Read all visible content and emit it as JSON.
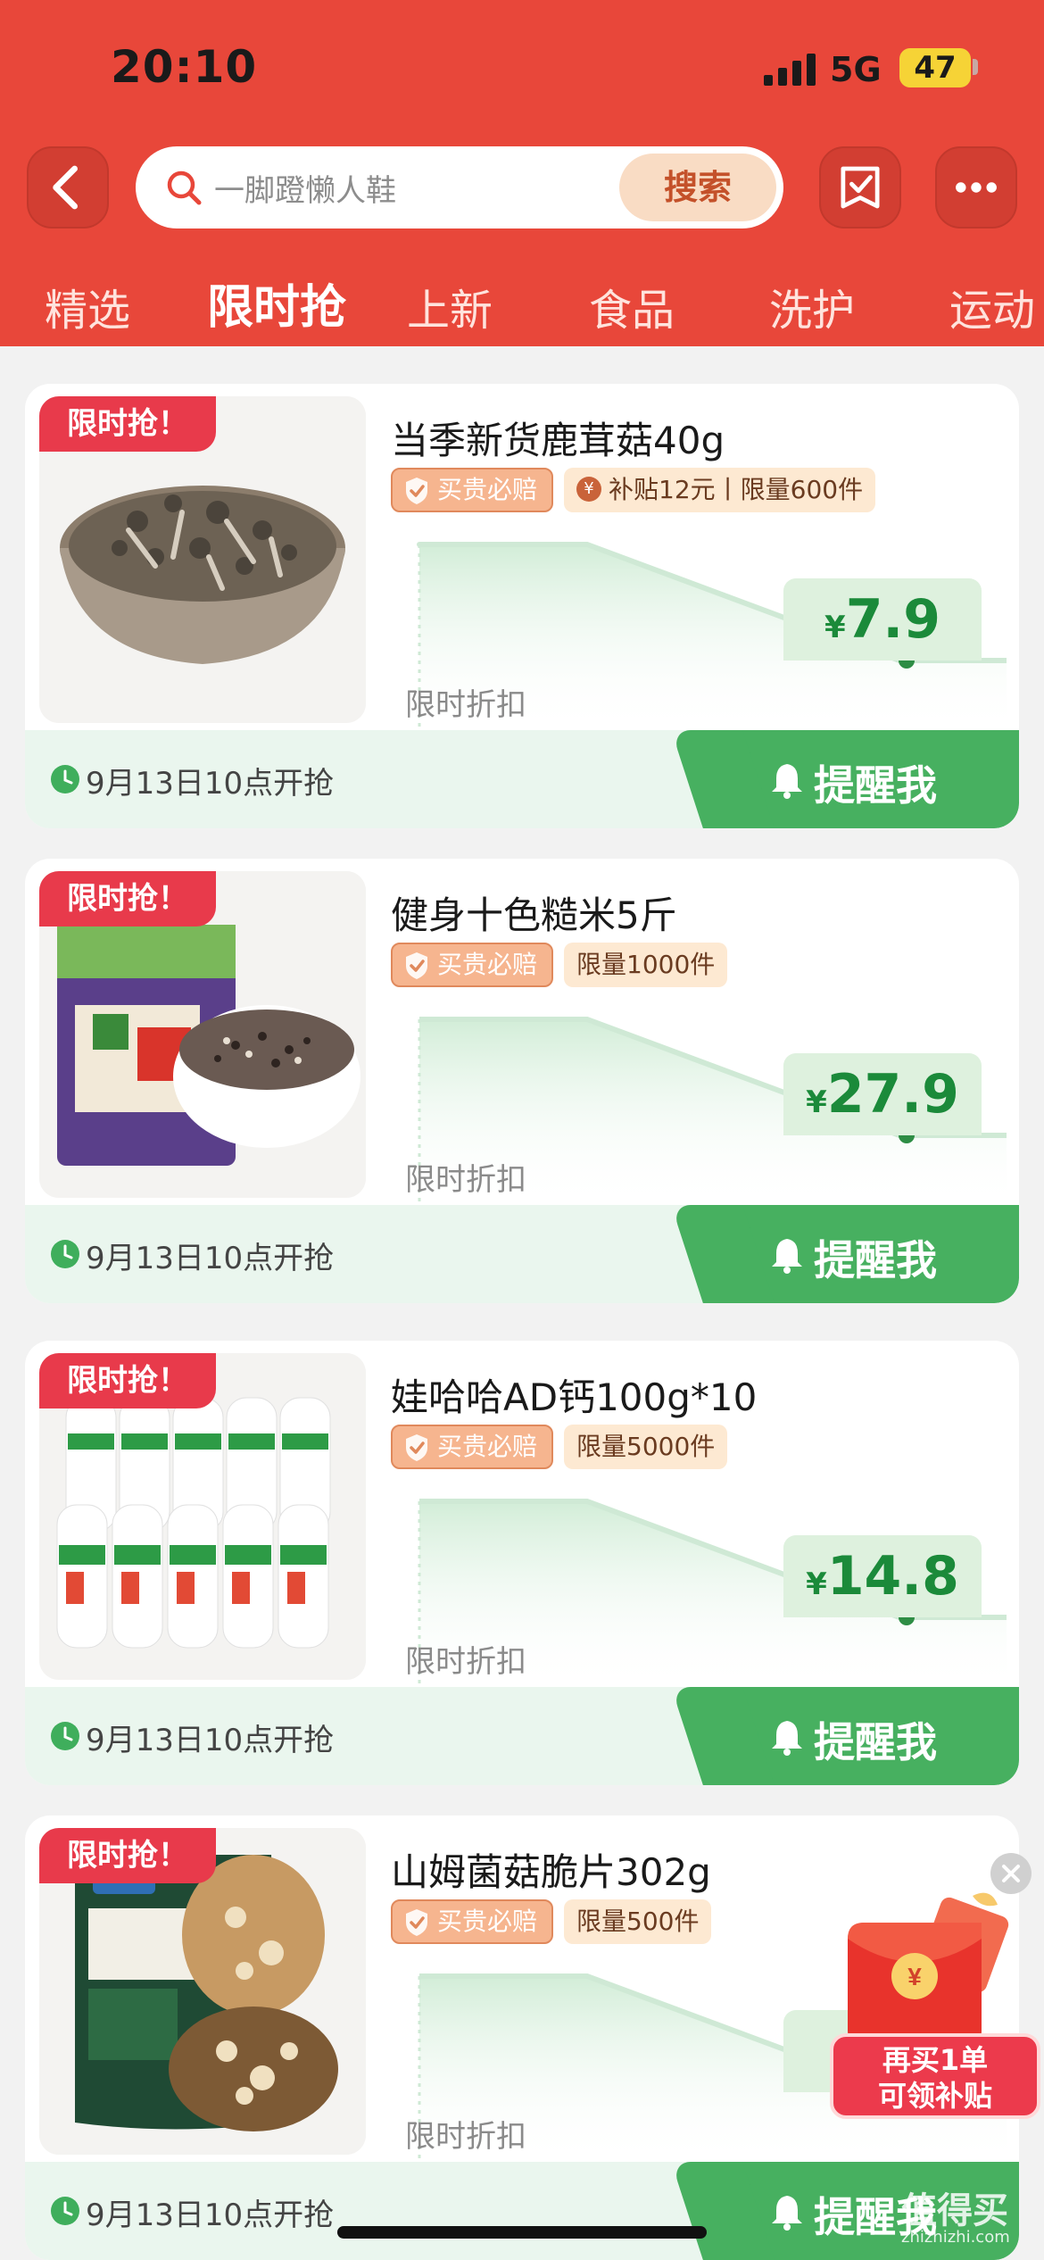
{
  "status_bar": {
    "time": "20:10",
    "network": "5G",
    "battery": "47"
  },
  "search": {
    "placeholder": "一脚蹬懒人鞋",
    "button_label": "搜索"
  },
  "tabs": [
    {
      "label": "精选",
      "active": false
    },
    {
      "label": "限时抢",
      "active": true
    },
    {
      "label": "上新",
      "active": false
    },
    {
      "label": "食品",
      "active": false
    },
    {
      "label": "洗护",
      "active": false
    },
    {
      "label": "运动",
      "active": false
    }
  ],
  "products": [
    {
      "flash_tag": "限时抢！",
      "title": "当季新货鹿茸菇40g",
      "guarantee_badge": "买贵必赔",
      "limit_badge": "补贴12元丨限量600件",
      "trend_label": "限时折扣",
      "currency": "¥",
      "price": "7.9",
      "start_time": "9月13日10点开抢",
      "remind_label": "提醒我"
    },
    {
      "flash_tag": "限时抢！",
      "title": "健身十色糙米5斤",
      "guarantee_badge": "买贵必赔",
      "limit_badge": "限量1000件",
      "trend_label": "限时折扣",
      "currency": "¥",
      "price": "27.9",
      "start_time": "9月13日10点开抢",
      "remind_label": "提醒我"
    },
    {
      "flash_tag": "限时抢！",
      "title": "娃哈哈AD钙100g*10",
      "guarantee_badge": "买贵必赔",
      "limit_badge": "限量5000件",
      "trend_label": "限时折扣",
      "currency": "¥",
      "price": "14.8",
      "start_time": "9月13日10点开抢",
      "remind_label": "提醒我"
    },
    {
      "flash_tag": "限时抢！",
      "title": "山姆菌菇脆片302g",
      "guarantee_badge": "买贵必赔",
      "limit_badge": "限量500件",
      "trend_label": "限时折扣",
      "currency": "¥",
      "price": "",
      "start_time": "9月13日10点开抢",
      "remind_label": "提醒我"
    }
  ],
  "floating_promo": {
    "line1": "再买1单",
    "line2": "可领补贴",
    "packet_symbol": "¥"
  },
  "watermark": {
    "main": "值得买",
    "sub": "zhizhizhi.com"
  },
  "colors": {
    "header_red": "#e8473a",
    "flash_tag_red": "#e83a4b",
    "price_green": "#1b8a3a",
    "remind_green": "#47b060",
    "search_btn_bg": "#f9dcc4",
    "search_btn_text": "#c4512a"
  }
}
